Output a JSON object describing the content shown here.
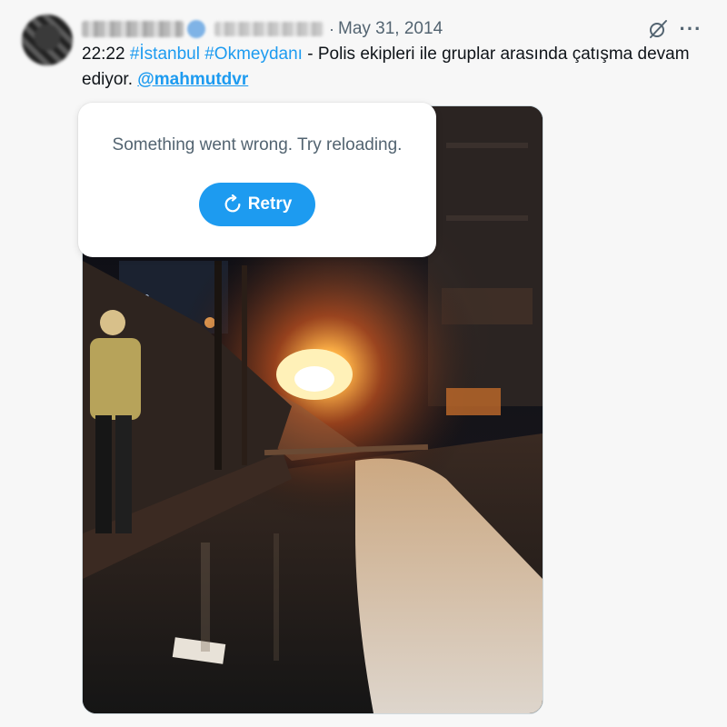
{
  "tweet": {
    "author": {
      "avatar_icon": "avatar-blurred",
      "name_hidden": true,
      "verified_icon": "verified-badge-icon"
    },
    "separator": "·",
    "date": "May 31, 2014",
    "text": {
      "time": "22:22 ",
      "hashtag_1": "#İstanbul",
      "hashtag_2": "#Okmeydanı",
      "body": " - Polis ekipleri ile gruplar arasında çatışma devam ediyor. ",
      "mention": "@mahmutdvr"
    },
    "icons": {
      "grok": "grok-icon",
      "more": "more-options-icon"
    },
    "more_label": "···"
  },
  "media_error": {
    "message": "Something went wrong. Try reloading.",
    "retry_label": "Retry",
    "retry_icon": "refresh-icon"
  },
  "colors": {
    "accent": "#1d9bf0",
    "secondary_text": "#536471",
    "primary_text": "#0f1419",
    "background": "#f7f7f7"
  }
}
